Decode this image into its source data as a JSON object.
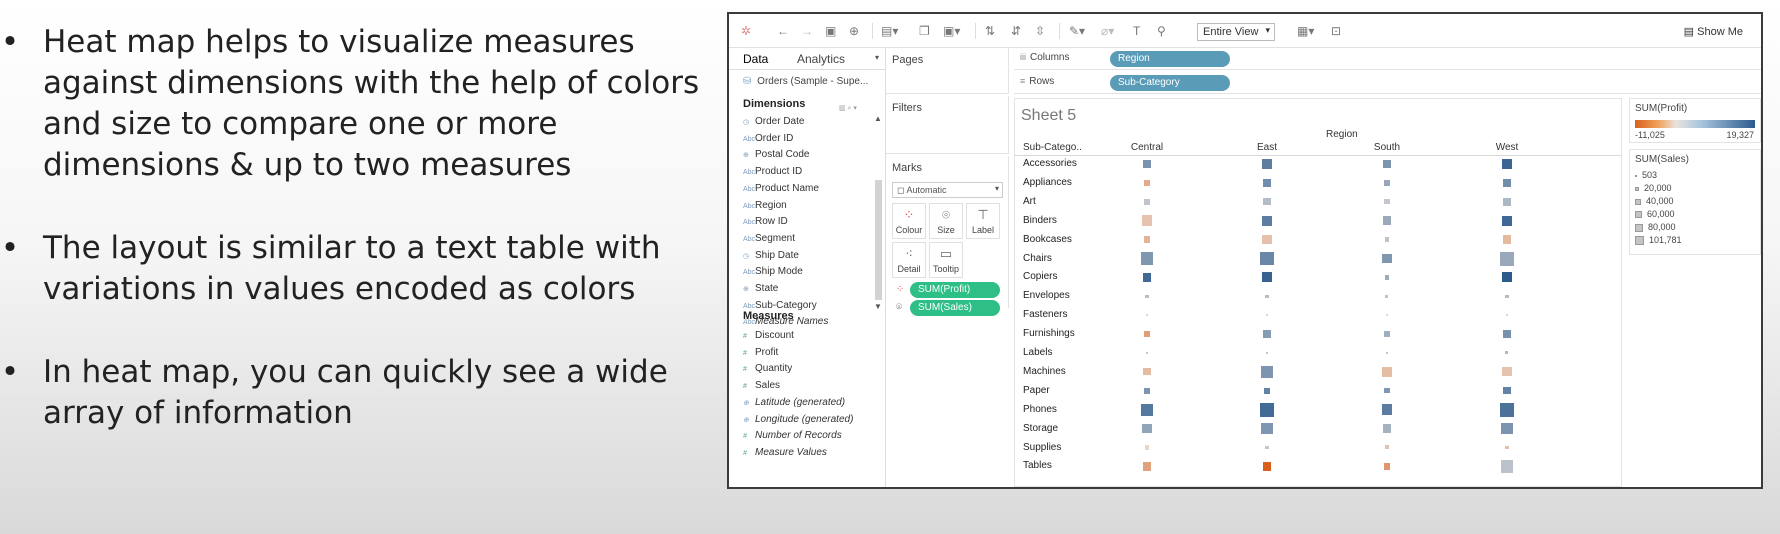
{
  "bullets": [
    "Heat map helps to visualize measures against dimensions with the help of colors and size to compare one or more dimensions & up to two measures",
    "The layout is similar to a text table with variations in values encoded as colors",
    "In heat map, you can quickly see a wide array of information"
  ],
  "bullet_glyph": "•",
  "toolbar": {
    "fit_label": "Entire View",
    "show_me_label": "Show Me"
  },
  "datapane": {
    "tab_data": "Data",
    "tab_analytics": "Analytics",
    "source": "Orders (Sample - Supe...",
    "dimensions_title": "Dimensions",
    "dimensions": [
      {
        "label": "Order Date",
        "icon": "calendar-icon",
        "italic": false
      },
      {
        "label": "Order ID",
        "icon": "abc-icon",
        "italic": false
      },
      {
        "label": "Postal Code",
        "icon": "globe-icon",
        "italic": false
      },
      {
        "label": "Product ID",
        "icon": "abc-icon",
        "italic": false
      },
      {
        "label": "Product Name",
        "icon": "abc-icon",
        "italic": false
      },
      {
        "label": "Region",
        "icon": "abc-icon",
        "italic": false
      },
      {
        "label": "Row ID",
        "icon": "abc-icon",
        "italic": false
      },
      {
        "label": "Segment",
        "icon": "abc-icon",
        "italic": false
      },
      {
        "label": "Ship Date",
        "icon": "calendar-icon",
        "italic": false
      },
      {
        "label": "Ship Mode",
        "icon": "abc-icon",
        "italic": false
      },
      {
        "label": "State",
        "icon": "globe-icon",
        "italic": false
      },
      {
        "label": "Sub-Category",
        "icon": "abc-icon",
        "italic": false
      },
      {
        "label": "Measure Names",
        "icon": "abc-icon",
        "italic": true
      }
    ],
    "measures_title": "Measures",
    "measures": [
      {
        "label": "Discount",
        "icon": "number-icon",
        "italic": false
      },
      {
        "label": "Profit",
        "icon": "number-icon",
        "italic": false
      },
      {
        "label": "Quantity",
        "icon": "number-icon",
        "italic": false
      },
      {
        "label": "Sales",
        "icon": "number-icon",
        "italic": false
      },
      {
        "label": "Latitude (generated)",
        "icon": "globe-icon",
        "italic": true
      },
      {
        "label": "Longitude (generated)",
        "icon": "globe-icon",
        "italic": true
      },
      {
        "label": "Number of Records",
        "icon": "number-icon",
        "italic": true
      },
      {
        "label": "Measure Values",
        "icon": "number-icon",
        "italic": true
      }
    ]
  },
  "cards": {
    "pages": "Pages",
    "filters": "Filters",
    "marks": "Marks",
    "mark_type": "Automatic",
    "buttons": [
      "Colour",
      "Size",
      "Label",
      "Detail",
      "Tooltip"
    ],
    "color_pill": "SUM(Profit)",
    "size_pill": "SUM(Sales)"
  },
  "shelves": {
    "columns_label": "Columns",
    "columns_pill": "Region",
    "rows_label": "Rows",
    "rows_pill": "Sub-Category"
  },
  "viz": {
    "sheet_title": "Sheet 5",
    "row_header": "Sub-Catego..",
    "column_header": "Region",
    "regions": [
      "Central",
      "East",
      "South",
      "West"
    ],
    "subcategories": [
      "Accessories",
      "Appliances",
      "Art",
      "Binders",
      "Bookcases",
      "Chairs",
      "Copiers",
      "Envelopes",
      "Fasteners",
      "Furnishings",
      "Labels",
      "Machines",
      "Paper",
      "Phones",
      "Storage",
      "Supplies",
      "Tables"
    ],
    "sales": [
      [
        33957,
        47616,
        27277,
        58784
      ],
      [
        23582,
        34188,
        19525,
        30236
      ],
      [
        17250,
        27119,
        13797,
        34025
      ],
      [
        56923,
        53498,
        37030,
        55962
      ],
      [
        24157,
        43819,
        10899,
        36004
      ],
      [
        85231,
        96248,
        45176,
        101781
      ],
      [
        37260,
        53219,
        9300,
        50236
      ],
      [
        5325,
        4818,
        4705,
        4758
      ],
      [
        778,
        899,
        503,
        844
      ],
      [
        15255,
        29072,
        17307,
        30073
      ],
      [
        2451,
        2903,
        2353,
        4708
      ],
      [
        26797,
        66106,
        53891,
        42444
      ],
      [
        17492,
        20173,
        14151,
        26664
      ],
      [
        72403,
        100615,
        58304,
        98684
      ],
      [
        45930,
        71613,
        35768,
        70532
      ],
      [
        8594,
        7333,
        8319,
        7814
      ],
      [
        39155,
        39140,
        21033,
        84755
      ]
    ],
    "profit": [
      [
        7252,
        11196,
        7005,
        16485
      ],
      [
        -2639,
        8391,
        4124,
        8261
      ],
      [
        1195,
        1900,
        1059,
        2374
      ],
      [
        -1044,
        11268,
        3901,
        16096
      ],
      [
        -1998,
        -1167,
        1339,
        -1646
      ],
      [
        6593,
        9357,
        6612,
        4028
      ],
      [
        15609,
        17023,
        3659,
        19328
      ],
      [
        1778,
        1812,
        1465,
        1909
      ],
      [
        237,
        264,
        174,
        275
      ],
      [
        -3906,
        5881,
        3443,
        7642
      ],
      [
        1073,
        1130,
        1129,
        2303
      ],
      [
        -1486,
        6929,
        -1439,
        -1024
      ],
      [
        6972,
        10183,
        6686,
        10185
      ],
      [
        12323,
        15247,
        11220,
        13695
      ],
      [
        4741,
        6718,
        2978,
        7092
      ],
      [
        -243,
        1012,
        -1127,
        -1193
      ],
      [
        -3559,
        -11025,
        -4623,
        1483
      ]
    ]
  },
  "legends": {
    "profit_title": "SUM(Profit)",
    "profit_min": "-11,025",
    "profit_max": "19,327",
    "sales_title": "SUM(Sales)",
    "sales_items": [
      "503",
      "20,000",
      "40,000",
      "60,000",
      "80,000",
      "101,781"
    ]
  },
  "colors": {
    "pill_green": "#2dbf86",
    "pill_blue": "#5a9cb8",
    "profit_negative": "#d9611f",
    "profit_neutral": "#e9e3dd",
    "profit_positive": "#2b5a8c"
  }
}
